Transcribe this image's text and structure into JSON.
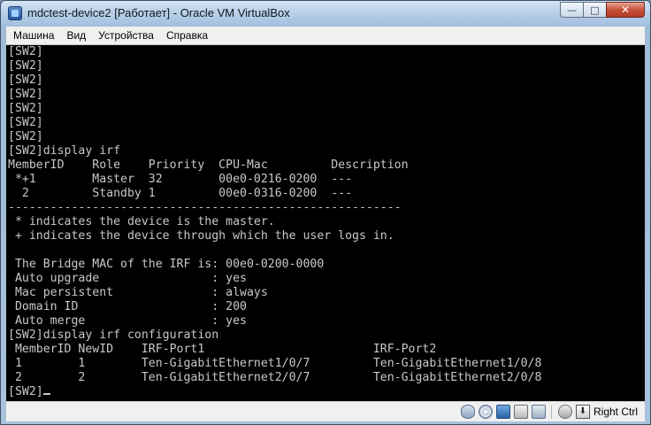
{
  "window": {
    "title": "mdctest-device2 [Работает] - Oracle VM VirtualBox",
    "buttons": {
      "minimize": "—",
      "maximize": "□",
      "close": "✕"
    }
  },
  "menu": {
    "items": [
      "Машина",
      "Вид",
      "Устройства",
      "Справка"
    ]
  },
  "console": {
    "lines": [
      "[SW2]",
      "[SW2]",
      "[SW2]",
      "[SW2]",
      "[SW2]",
      "[SW2]",
      "[SW2]",
      "[SW2]display irf",
      "MemberID    Role    Priority  CPU-Mac         Description",
      " *+1        Master  32        00e0-0216-0200  ---",
      "  2         Standby 1         00e0-0316-0200  ---",
      "--------------------------------------------------------",
      " * indicates the device is the master.",
      " + indicates the device through which the user logs in.",
      "",
      " The Bridge MAC of the IRF is: 00e0-0200-0000",
      " Auto upgrade                : yes",
      " Mac persistent              : always",
      " Domain ID                   : 200",
      " Auto merge                  : yes",
      "[SW2]display irf configuration",
      " MemberID NewID    IRF-Port1                        IRF-Port2",
      " 1        1        Ten-GigabitEthernet1/0/7         Ten-GigabitEthernet1/0/8",
      " 2        2        Ten-GigabitEthernet2/0/7         Ten-GigabitEthernet2/0/8",
      "[SW2]"
    ]
  },
  "statusbar": {
    "icons": [
      "hdd-icon",
      "optical-drive-icon",
      "network-icon",
      "usb-icon",
      "shared-folder-icon",
      "mouse-integration-icon",
      "host-key-icon"
    ],
    "host_key_label": "Right Ctrl"
  }
}
